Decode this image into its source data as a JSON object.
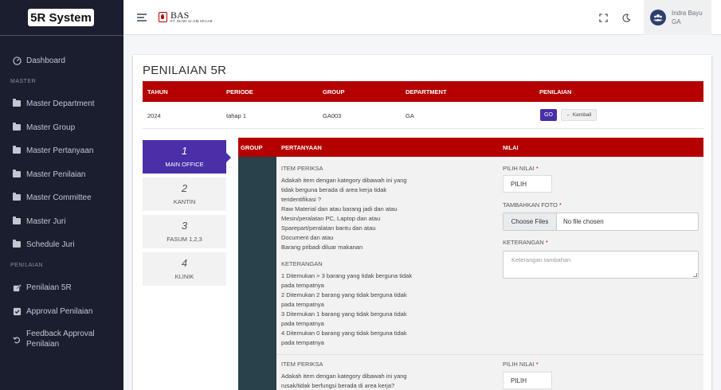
{
  "sidebar": {
    "brand": "5R System",
    "dashboard": "Dashboard",
    "header_master": "MASTER",
    "master_items": [
      "Master Department",
      "Master Group",
      "Master Pertanyaan",
      "Master Penilaian",
      "Master Committee",
      "Master Juri",
      "Schedule Juri"
    ],
    "header_penilaian": "PENILAIAN",
    "penilaian_items": [
      "Penilaian 5R",
      "Approval Penilaian"
    ],
    "feedback_line1": "Feedback Approval",
    "feedback_line2": "Penilaian"
  },
  "topbar": {
    "logo_text": "BAS",
    "logo_sub": "PT. BUMI ALAM SEGAR",
    "user_name": "Indra Bayu",
    "user_role": "GA"
  },
  "page": {
    "title": "PENILAIAN 5R",
    "table_headers": {
      "tahun": "TAHUN",
      "periode": "PERIODE",
      "group": "GROUP",
      "department": "DEPARTMENT",
      "penilaian": "PENILAIAN"
    },
    "row": {
      "tahun": "2024",
      "periode": "tahap 1",
      "group": "GA003",
      "department": "GA"
    },
    "btn_go": "GO",
    "btn_back": "← Kembali"
  },
  "locations": [
    {
      "num": "1",
      "name": "MAIN OFFICE"
    },
    {
      "num": "2",
      "name": "KANTIN"
    },
    {
      "num": "3",
      "name": "FASUM 1,2,3"
    },
    {
      "num": "4",
      "name": "KLINIK"
    }
  ],
  "questions": {
    "headers": {
      "group": "GROUP",
      "pertanyaan": "PERTANYAAN",
      "nilai": "NILAI"
    },
    "item_label": "ITEM PERIKSA",
    "q1_lines": [
      "Adakah item dengan kategory dibawah ini yang",
      "tidak berguna berada di area kerja tidak",
      "teridentifikasi ?",
      "Raw Material dan atau barang jadi dan atau",
      "Mesin/peralatan PC, Laptop dan atau",
      "Sparepart/peralatan bantu dan atau",
      "Document dan atau",
      "Barang pribadi diluar makanan"
    ],
    "keterangan_label": "KETERANGAN",
    "k_lines": [
      "1 Ditemukan > 3 barang yang tidak berguna tidak",
      "pada tempatnya",
      "2 Ditemukan 2 barang yang tidak berguna tidak",
      "pada tempatnya",
      "3 Ditemukan 1 barang yang tidak berguna tidak",
      "pada tempatnya",
      "4 Ditemukan 0 barang yang tidak berguna tidak",
      "pada tempatnya"
    ],
    "q2_lines": [
      "Adakah item dengan kategory dibawah ini yang",
      "rusak/tidak berfungsi berada di area kerja?"
    ],
    "pilih_nilai": "PILIH NILAI",
    "pilih": "PILIH",
    "tambah_foto": "TAMBAHKAN FOTO",
    "choose_files": "Choose Files",
    "no_file": "No file chosen",
    "keterangan_field": "KETERANGAN",
    "keterangan_placeholder": "Keterangan tambahan",
    "required_mark": "*"
  }
}
